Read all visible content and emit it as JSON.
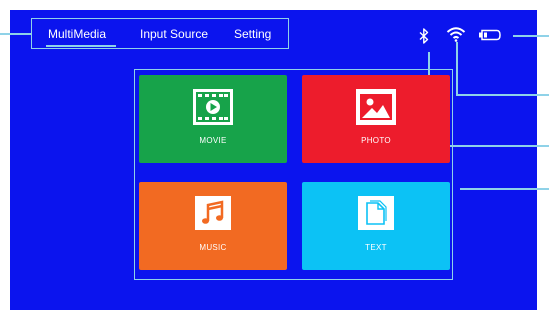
{
  "nav": {
    "tabs": [
      {
        "label": "MultiMedia",
        "selected": true
      },
      {
        "label": "Input Source",
        "selected": false
      },
      {
        "label": "Setting",
        "selected": false
      }
    ]
  },
  "status": {
    "bluetooth_icon": "bluetooth-icon",
    "wifi_icon": "wifi-icon",
    "input_icon": "hdmi-input-icon"
  },
  "tiles": [
    {
      "label": "MOVIE",
      "icon": "film-icon",
      "color": "#17a34a"
    },
    {
      "label": "PHOTO",
      "icon": "image-icon",
      "color": "#ed1c2c"
    },
    {
      "label": "MUSIC",
      "icon": "music-note-icon",
      "color": "#f26a22"
    },
    {
      "label": "TEXT",
      "icon": "document-icon",
      "color": "#0cc2f5"
    }
  ],
  "colors": {
    "screen": "#0b14ee",
    "highlight": "#8fd2e8"
  }
}
